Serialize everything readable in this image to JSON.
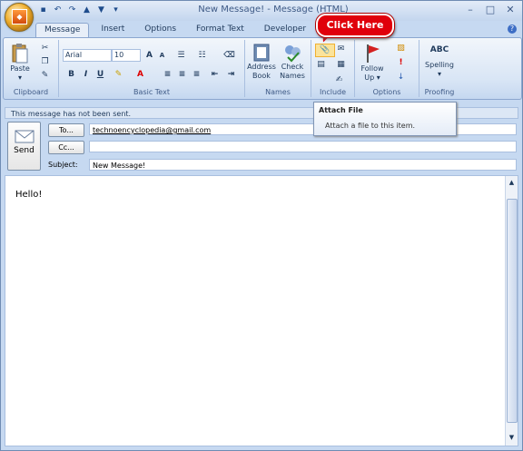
{
  "window": {
    "title": "New Message! - Message (HTML)",
    "controls": [
      "minimize-icon",
      "maximize-icon",
      "close-icon"
    ]
  },
  "tabs": [
    "Message",
    "Insert",
    "Options",
    "Format Text",
    "Developer"
  ],
  "ribbon": {
    "clipboard": {
      "paste_label": "Paste",
      "group_label": "Clipboard"
    },
    "basic_text": {
      "font": "Arial",
      "size": "10",
      "group_label": "Basic Text"
    },
    "names": {
      "address_book": "Address Book",
      "check_names": "Check Names",
      "group_label": "Names"
    },
    "include": {
      "group_label": "Include"
    },
    "options": {
      "follow_up": "Follow Up",
      "group_label": "Options"
    },
    "proofing": {
      "spelling": "Spelling",
      "abc": "ABC",
      "group_label": "Proofing"
    }
  },
  "callout": {
    "text": "Click Here"
  },
  "tooltip": {
    "title": "Attach File",
    "description": "Attach a file to this item."
  },
  "infobar": {
    "text": "This message has not been sent."
  },
  "compose": {
    "send_label": "Send",
    "to_button": "To...",
    "cc_button": "Cc...",
    "subject_label": "Subject:",
    "to_value": "technoencyclopedia@gmail.com",
    "cc_value": "",
    "subject_value": "New Message!",
    "body_text": "Hello!"
  },
  "colors": {
    "accent": "#1e395b",
    "callout": "#e0000b",
    "ribbon": "#d8e5f5"
  }
}
